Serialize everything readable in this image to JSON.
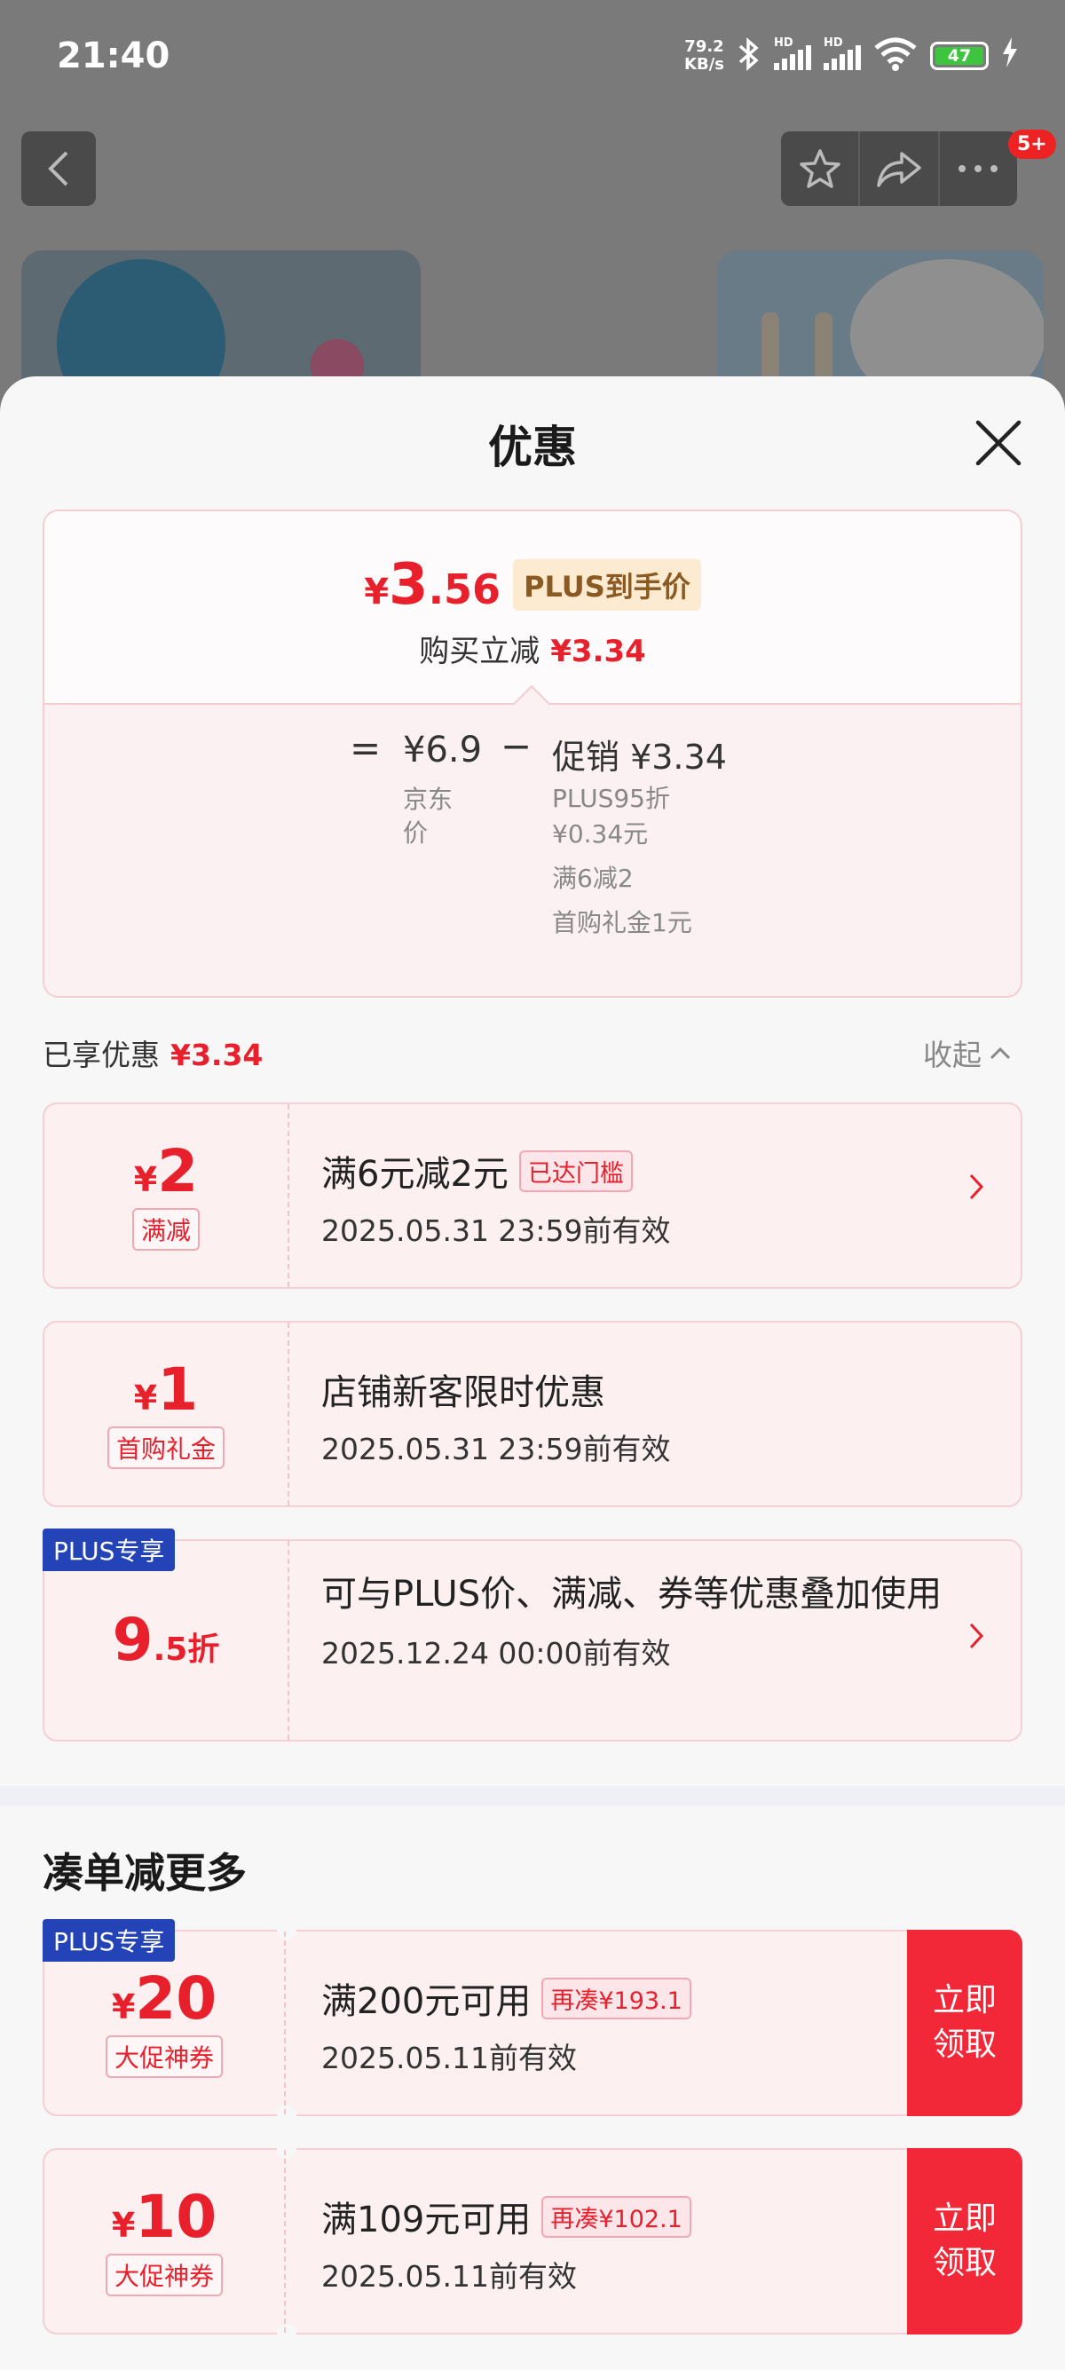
{
  "status": {
    "time": "21:40",
    "netspeed_value": "79.2",
    "netspeed_unit": "KB/s",
    "hd1": "HD",
    "hd2": "HD",
    "battery": "47"
  },
  "nav": {
    "badge": "5+"
  },
  "sheet": {
    "title": "优惠"
  },
  "summary": {
    "currency": "¥",
    "final_int": "3",
    "final_dec": ".56",
    "plus_tag": "PLUS到手价",
    "instant_label": "购买立减",
    "instant_value": "¥3.34",
    "equals": "=",
    "jd_price": "¥6.9",
    "jd_label": "京东价",
    "minus": "−",
    "promo_label": "促销 ¥3.34",
    "promo_items": [
      "PLUS95折¥0.34元",
      "满6减2",
      "首购礼金1元"
    ]
  },
  "enjoyed": {
    "label": "已享优惠",
    "value": "¥3.34",
    "collapse": "收起"
  },
  "coupons": [
    {
      "currency": "¥",
      "amount": "2",
      "type": "满减",
      "title": "满6元减2元",
      "tag": "已达门槛",
      "date": "2025.05.31 23:59前有效"
    },
    {
      "currency": "¥",
      "amount": "1",
      "type": "首购礼金",
      "title": "店铺新客限时优惠",
      "date": "2025.05.31 23:59前有效"
    },
    {
      "plus_label": "PLUS专享",
      "amount_int": "9",
      "amount_dec": ".5折",
      "title": "可与PLUS价、满减、券等优惠叠加使用",
      "date": "2025.12.24 00:00前有效"
    }
  ],
  "more": {
    "title": "凑单减更多",
    "items": [
      {
        "plus_label": "PLUS专享",
        "currency": "¥",
        "amount": "20",
        "type": "大促神券",
        "title": "满200元可用",
        "tag": "再凑¥193.1",
        "date": "2025.05.11前有效",
        "button": "立即领取"
      },
      {
        "currency": "¥",
        "amount": "10",
        "type": "大促神券",
        "title": "满109元可用",
        "tag": "再凑¥102.1",
        "date": "2025.05.11前有效",
        "button": "立即领取"
      }
    ]
  },
  "colors": {
    "accent_red": "#e8202c",
    "plus_blue": "#2443b6",
    "plus_gold_bg": "#fcebd0"
  }
}
